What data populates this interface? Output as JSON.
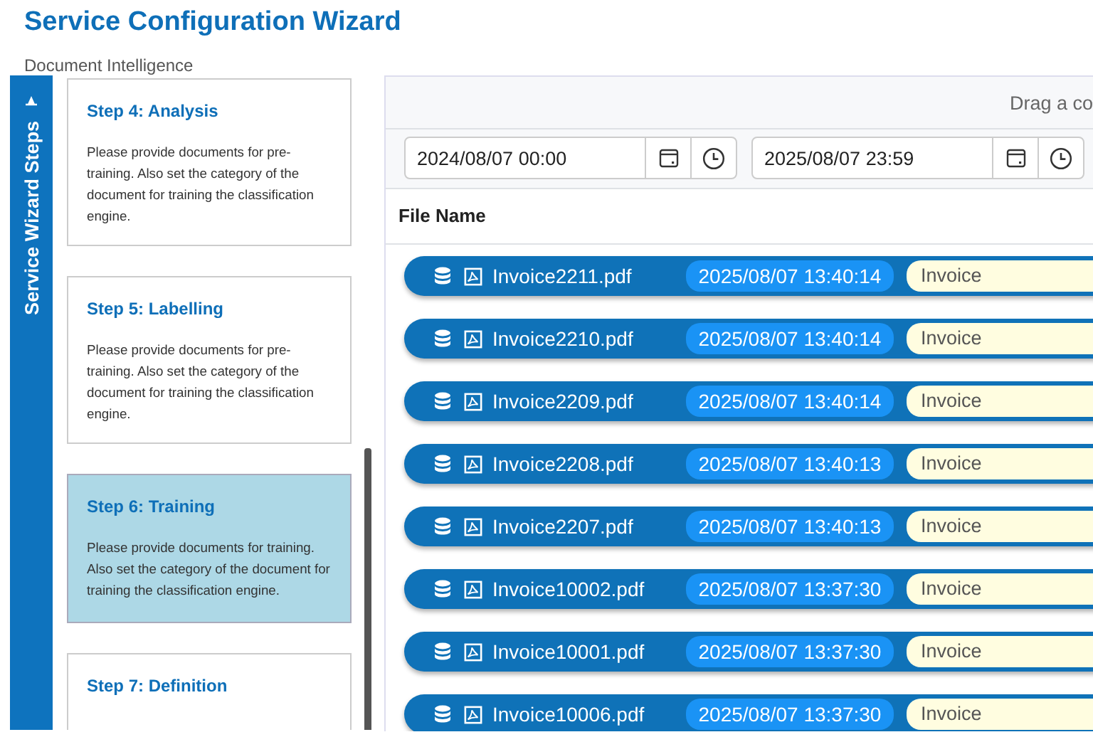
{
  "header": {
    "title": "Service Configuration Wizard",
    "subtitle": "Document Intelligence"
  },
  "sidebar": {
    "title": "Service Wizard Steps",
    "steps": [
      {
        "title": "Step 4: Analysis",
        "description": "Please provide documents for pre-training. Also set the category of the document for training the classification engine.",
        "selected": false
      },
      {
        "title": "Step 5: Labelling",
        "description": "Please provide documents for pre-training. Also set the category of the document for training the classification engine.",
        "selected": false
      },
      {
        "title": "Step 6: Training",
        "description": "Please provide documents for training. Also set the category of the document for training the classification engine.",
        "selected": true
      },
      {
        "title": "Step 7: Definition",
        "selected": false
      }
    ]
  },
  "grid": {
    "group_panel_hint": "Drag a co",
    "filters": [
      {
        "value": "2024/08/07 00:00"
      },
      {
        "value": "2025/08/07 23:59"
      }
    ],
    "columns": [
      "File Name"
    ],
    "rows": [
      {
        "file": "Invoice2211.pdf",
        "date": "2025/08/07 13:40:14",
        "category": "Invoice"
      },
      {
        "file": "Invoice2210.pdf",
        "date": "2025/08/07 13:40:14",
        "category": "Invoice"
      },
      {
        "file": "Invoice2209.pdf",
        "date": "2025/08/07 13:40:14",
        "category": "Invoice"
      },
      {
        "file": "Invoice2208.pdf",
        "date": "2025/08/07 13:40:13",
        "category": "Invoice"
      },
      {
        "file": "Invoice2207.pdf",
        "date": "2025/08/07 13:40:13",
        "category": "Invoice"
      },
      {
        "file": "Invoice10002.pdf",
        "date": "2025/08/07 13:37:30",
        "category": "Invoice"
      },
      {
        "file": "Invoice10001.pdf",
        "date": "2025/08/07 13:37:30",
        "category": "Invoice"
      },
      {
        "file": "Invoice10006.pdf",
        "date": "2025/08/07 13:37:30",
        "category": "Invoice"
      }
    ]
  }
}
